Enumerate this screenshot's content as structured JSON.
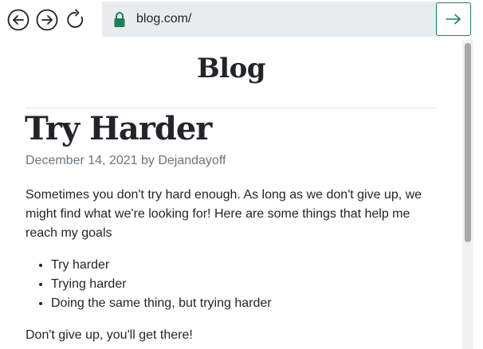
{
  "browser": {
    "address": "blog.com/",
    "icons": {
      "back": "arrow-left-circle-icon",
      "forward": "arrow-right-circle-icon",
      "reload": "reload-icon",
      "lock": "lock-icon",
      "go": "arrow-right-icon"
    },
    "colors": {
      "lock": "#1e7e5a",
      "go_border": "#1e7e5a",
      "address_bg": "#e8ecef"
    }
  },
  "page": {
    "site_title": "Blog",
    "post": {
      "title": "Try Harder",
      "meta": "December 14, 2021 by Dejandayoff",
      "intro": "Sometimes you don't try hard enough. As long as we don't give up, we might find what we're looking for! Here are some things that help me reach my goals",
      "list": [
        "Try harder",
        "Trying harder",
        "Doing the same thing, but trying harder"
      ],
      "closing": "Don't give up, you'll get there!"
    }
  }
}
